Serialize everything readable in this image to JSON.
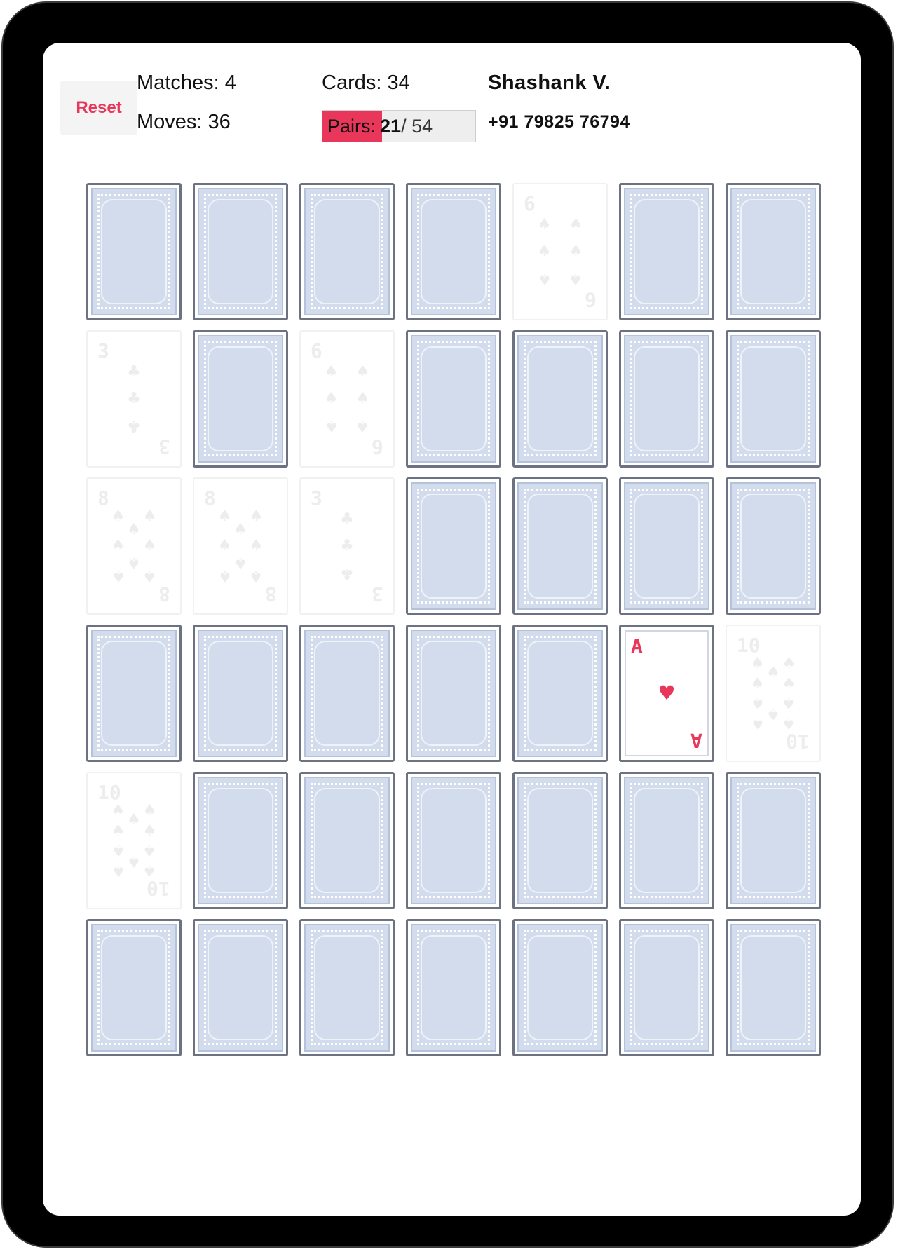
{
  "header": {
    "reset_label": "Reset",
    "matches": "Matches: 4",
    "moves": "Moves: 36",
    "cards": "Cards: 34",
    "pairs_label": "Pairs:",
    "pairs_found": "21",
    "pairs_total": "/ 54",
    "pairs_progress": 0.39,
    "player_name": "Shashank V.",
    "player_phone": "+91 79825 76794"
  },
  "colors": {
    "accent": "#e8375a",
    "card_back": "#d2dcec",
    "card_border": "#6c7282"
  },
  "board": {
    "columns": 7,
    "cards": [
      {
        "state": "back"
      },
      {
        "state": "back"
      },
      {
        "state": "back"
      },
      {
        "state": "back"
      },
      {
        "state": "matched",
        "rank": "6",
        "suit": "spade"
      },
      {
        "state": "back"
      },
      {
        "state": "back"
      },
      {
        "state": "matched",
        "rank": "3",
        "suit": "club"
      },
      {
        "state": "back"
      },
      {
        "state": "matched",
        "rank": "6",
        "suit": "spade"
      },
      {
        "state": "back"
      },
      {
        "state": "back"
      },
      {
        "state": "back"
      },
      {
        "state": "back"
      },
      {
        "state": "matched",
        "rank": "8",
        "suit": "spade"
      },
      {
        "state": "matched",
        "rank": "8",
        "suit": "spade"
      },
      {
        "state": "matched",
        "rank": "3",
        "suit": "club"
      },
      {
        "state": "back"
      },
      {
        "state": "back"
      },
      {
        "state": "back"
      },
      {
        "state": "back"
      },
      {
        "state": "back"
      },
      {
        "state": "back"
      },
      {
        "state": "back"
      },
      {
        "state": "back"
      },
      {
        "state": "back"
      },
      {
        "state": "face",
        "rank": "A",
        "suit": "heart"
      },
      {
        "state": "matched",
        "rank": "10",
        "suit": "spade"
      },
      {
        "state": "matched",
        "rank": "10",
        "suit": "spade"
      },
      {
        "state": "back"
      },
      {
        "state": "back"
      },
      {
        "state": "back"
      },
      {
        "state": "back"
      },
      {
        "state": "back"
      },
      {
        "state": "back"
      },
      {
        "state": "back"
      },
      {
        "state": "back"
      },
      {
        "state": "back"
      },
      {
        "state": "back"
      },
      {
        "state": "back"
      },
      {
        "state": "back"
      },
      {
        "state": "back"
      }
    ]
  }
}
